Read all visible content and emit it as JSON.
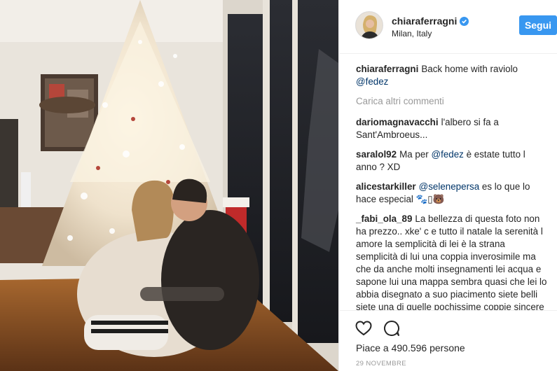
{
  "post": {
    "author": "chiaraferragni",
    "location": "Milan, Italy",
    "follow_label": "Segui",
    "caption_user": "chiaraferragni",
    "caption_text": "Back home with raviolo",
    "caption_mention": "@fedez",
    "load_more_label": "Carica altri commenti",
    "likes": "Piace a 490.596 persone",
    "date": "29 NOVEMBRE"
  },
  "comments": [
    {
      "user": "dariomagnavacchi",
      "pre": "l'albero si fa a Sant'Ambroeus...",
      "mention": "",
      "post": ""
    },
    {
      "user": "saralol92",
      "pre": "Ma per",
      "mention": "@fedez",
      "post": "è estate tutto l anno ? XD"
    },
    {
      "user": "alicestarkiller",
      "pre": "",
      "mention": "@selenepersa",
      "post": "es lo que lo hace especial 🐾▯🐻"
    },
    {
      "user": "_fabi_ola_89",
      "pre": "La bellezza di questa foto non ha prezzo.. xke' c e tutto il natale la serenità l amore la semplicità di lei è la strana semplicità di lui una coppia inverosimile ma che da anche molti insegnamenti lei acqua e sapone lui una mappa sembra quasi che lei lo abbia disegnato a suo piacimento siete belli siete una di quelle pochissime coppie sincere che non si ferma dinanzi a l",
      "mention": "",
      "post": ""
    }
  ],
  "icons": {
    "verified": "verified-badge-icon",
    "heart": "heart-icon",
    "comment": "comment-icon"
  },
  "colors": {
    "accent": "#3897f0",
    "mention": "#003569",
    "muted": "#999999"
  }
}
